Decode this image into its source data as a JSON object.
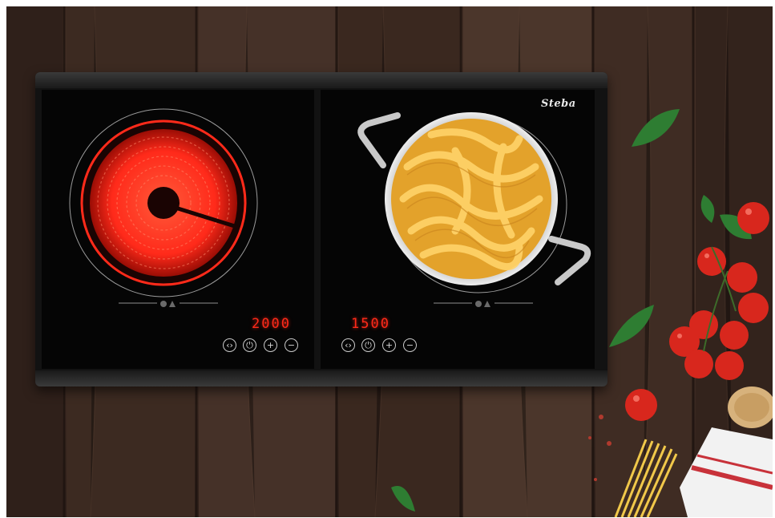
{
  "brand": {
    "logo_text": "Steba"
  },
  "zones": [
    {
      "name": "left-hob",
      "display_value": "2000"
    },
    {
      "name": "right-hob",
      "display_value": "1500"
    }
  ],
  "controls": [
    {
      "icon": "timer-arrows-icon",
      "glyph": "‹›"
    },
    {
      "icon": "power-icon",
      "glyph": "⏻"
    },
    {
      "icon": "plus-icon",
      "glyph": "+"
    },
    {
      "icon": "minus-icon",
      "glyph": "−"
    }
  ],
  "colors": {
    "wood_dark": "#2b1d17",
    "wood_light": "#4a342a",
    "glass": "#050505",
    "heat_red": "#ff2a1a",
    "pasta": "#f2b93b",
    "tomato": "#d8271d",
    "basil": "#2e7d32"
  }
}
